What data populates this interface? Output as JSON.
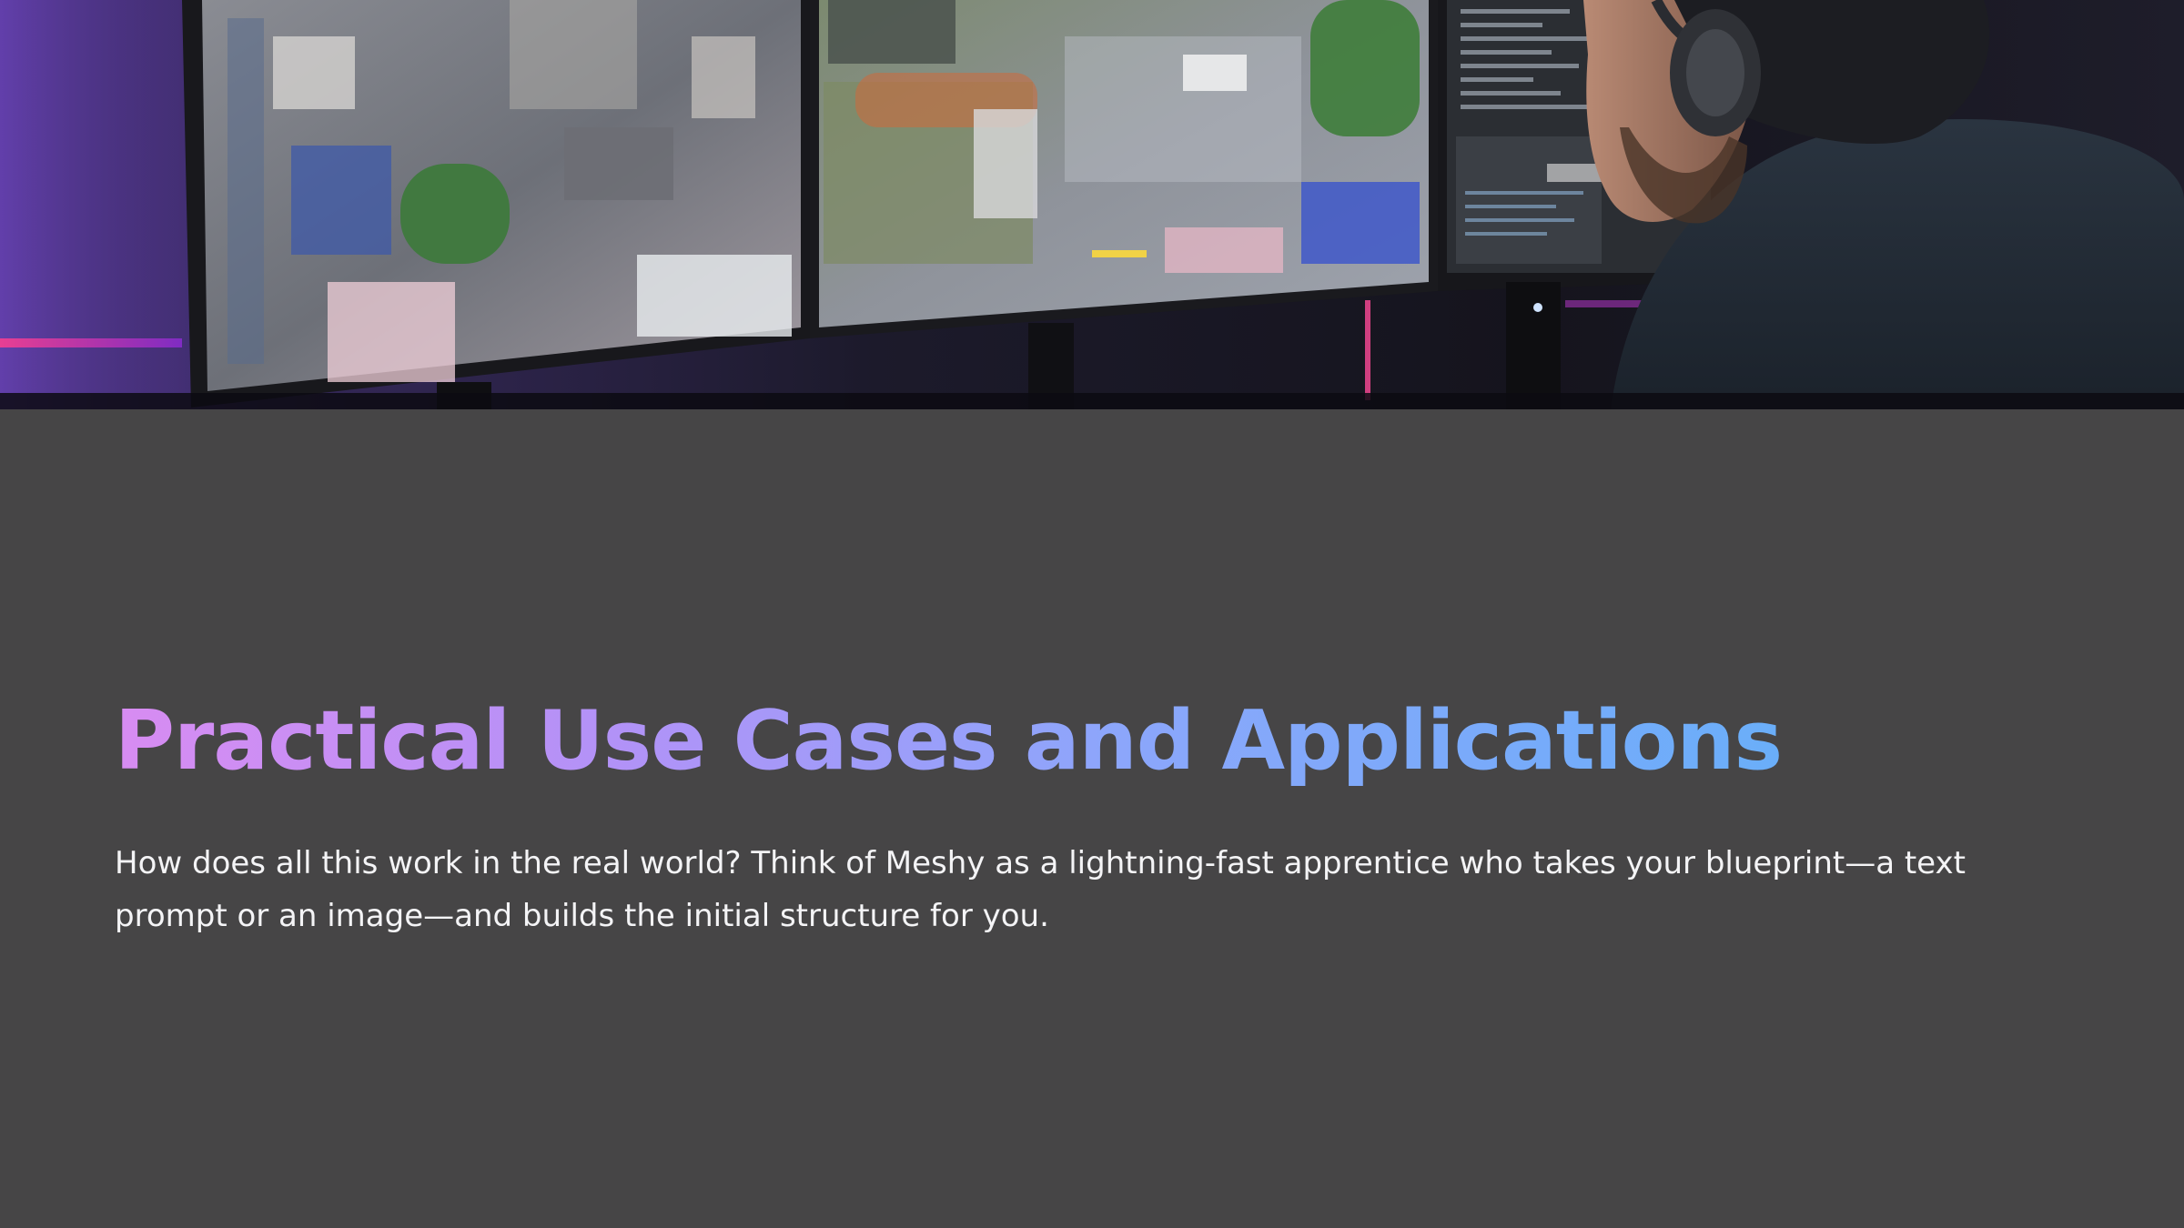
{
  "slide": {
    "title": "Practical Use Cases and Applications",
    "body": "How does all this work in the real world? Think of Meshy as a lightning-fast apprentice who takes your blueprint—a text prompt or an image—and builds the initial structure for you."
  },
  "hero_image": {
    "subject": "developer with headphones at three monitors showing a 3D city scene and editor panels"
  },
  "colors": {
    "background": "#464546",
    "title_gradient_start": "#d88cf2",
    "title_gradient_end": "#6aaef9",
    "body_text": "#f4f4f6"
  }
}
